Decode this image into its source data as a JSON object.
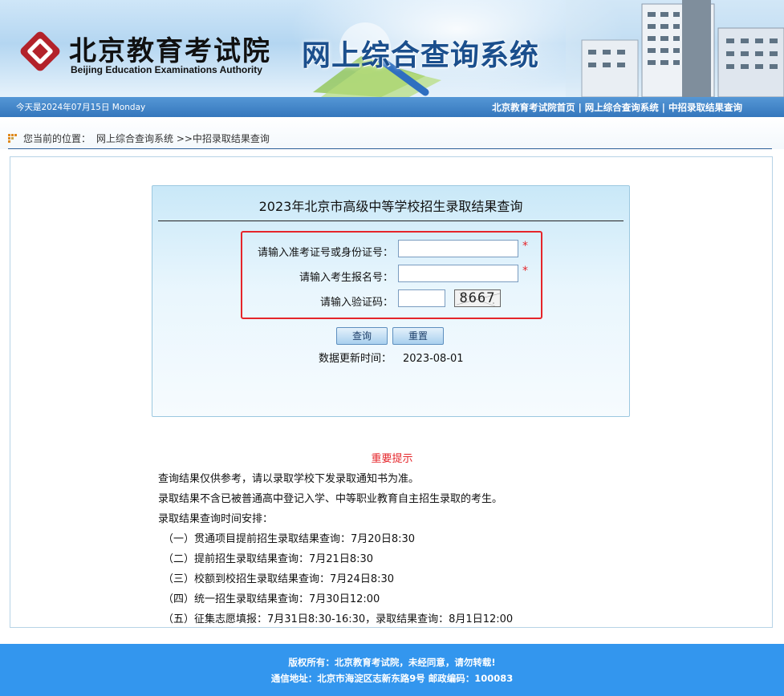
{
  "header": {
    "logo_cn": "北京教育考试院",
    "logo_en": "Beijing Education Examinations Authority",
    "system_title": "网上综合查询系统"
  },
  "topbar": {
    "date": "今天是2024年07月15日 Monday",
    "links": [
      {
        "label": "北京教育考试院首页"
      },
      {
        "label": "网上综合查询系统"
      },
      {
        "label": "中招录取结果查询"
      }
    ],
    "separator": "|"
  },
  "location": {
    "label": "您当前的位置：",
    "path": "网上综合查询系统 >>中招录取结果查询"
  },
  "panel": {
    "title": "2023年北京市高级中等学校招生录取结果查询",
    "fields": [
      {
        "label": "请输入准考证号或身份证号：",
        "value": "",
        "placeholder": "",
        "required_mark": "*"
      },
      {
        "label": "请输入考生报名号：",
        "value": "",
        "placeholder": "",
        "required_mark": "*"
      },
      {
        "label": "请输入验证码：",
        "value": "",
        "placeholder": ""
      }
    ],
    "captcha_text": "8667",
    "buttons": {
      "query": "查询",
      "reset": "重置"
    },
    "update_label": "数据更新时间：",
    "update_value": "2023-08-01"
  },
  "notice": {
    "title": "重要提示",
    "lines": [
      "查询结果仅供参考，请以录取学校下发录取通知书为准。",
      "录取结果不含已被普通高中登记入学、中等职业教育自主招生录取的考生。",
      "录取结果查询时间安排："
    ],
    "schedule": [
      "（一）贯通项目提前招生录取结果查询：7月20日8:30",
      "（二）提前招生录取结果查询：7月21日8:30",
      "（三）校额到校招生录取结果查询：7月24日8:30",
      "（四）统一招生录取结果查询：7月30日12:00",
      "（五）征集志愿填报：7月31日8:30-16:30，录取结果查询：8月1日12:00"
    ]
  },
  "footer": {
    "copyright": "版权所有：北京教育考试院，未经同意，请勿转载!",
    "address": "通信地址：北京市海淀区志新东路9号 邮政编码：100083"
  },
  "colors": {
    "banner_title": "#1b4f8d",
    "topbar": "#3577bd",
    "highlight_border": "#e5252a",
    "footer": "#3396ee",
    "logo_red": "#b3222a"
  }
}
